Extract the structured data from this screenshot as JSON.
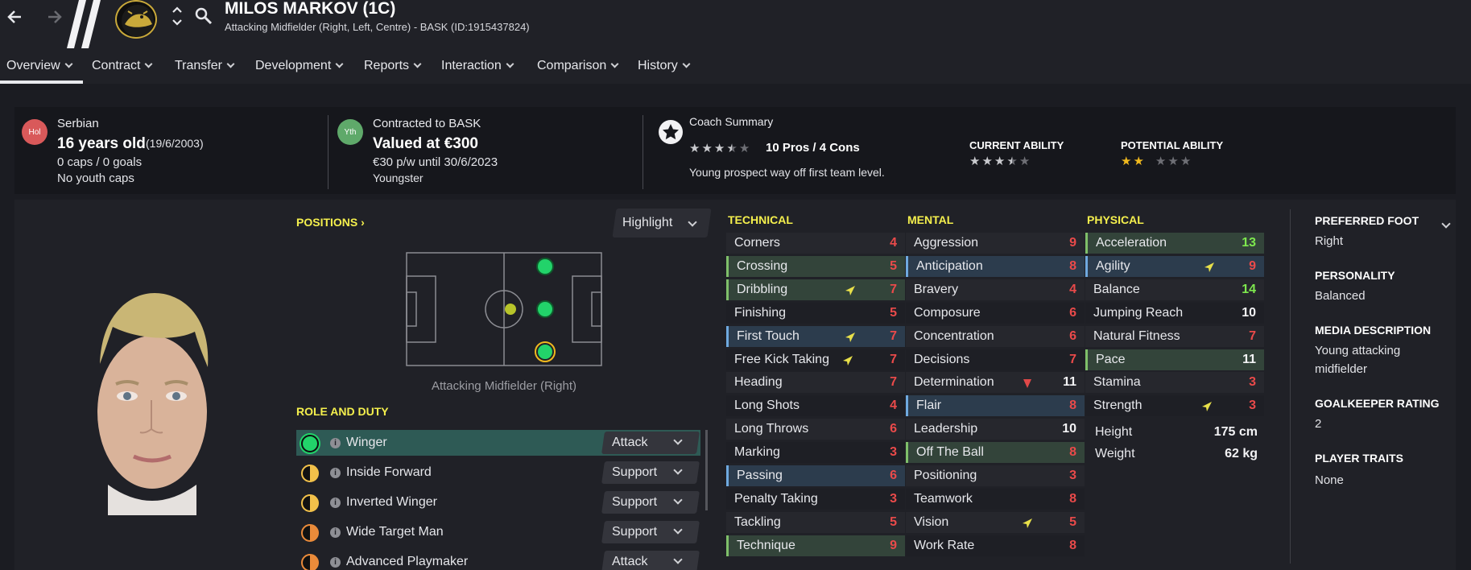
{
  "header": {
    "title": "MILOS MARKOV (1C)",
    "subtitle": "Attacking Midfielder (Right, Left, Centre) - BASK (ID:1915437824)"
  },
  "tabs": [
    "Overview",
    "Contract",
    "Transfer",
    "Development",
    "Reports",
    "Interaction",
    "Comparison",
    "History"
  ],
  "info": {
    "nation_badge": "Hol",
    "nationality": "Serbian",
    "age": "16 years old",
    "dob": "(19/6/2003)",
    "caps": "0 caps / 0 goals",
    "youth_caps": "No youth caps",
    "contract_badge": "Yth",
    "contracted": "Contracted to BASK",
    "valued": "Valued at €300",
    "wage": "€30 p/w until 30/6/2023",
    "status": "Youngster",
    "coach_title": "Coach Summary",
    "coach_rating": 3.5,
    "pros_cons": "10 Pros / 4 Cons",
    "coach_text": "Young prospect way off first team level.",
    "current_ability_label": "CURRENT ABILITY",
    "current_ability": 3.5,
    "potential_ability_label": "POTENTIAL ABILITY",
    "potential_ability": 2
  },
  "positions": {
    "label": "POSITIONS",
    "highlight": "Highlight",
    "caption": "Attacking Midfielder (Right)"
  },
  "roles": {
    "label": "ROLE AND DUTY",
    "items": [
      {
        "name": "Winger",
        "duty": "Attack"
      },
      {
        "name": "Inside Forward",
        "duty": "Support"
      },
      {
        "name": "Inverted Winger",
        "duty": "Support"
      },
      {
        "name": "Wide Target Man",
        "duty": "Support"
      },
      {
        "name": "Advanced Playmaker",
        "duty": "Attack"
      }
    ]
  },
  "technical": {
    "label": "TECHNICAL",
    "items": [
      {
        "name": "Corners",
        "value": "4"
      },
      {
        "name": "Crossing",
        "value": "5"
      },
      {
        "name": "Dribbling",
        "value": "7"
      },
      {
        "name": "Finishing",
        "value": "5"
      },
      {
        "name": "First Touch",
        "value": "7"
      },
      {
        "name": "Free Kick Taking",
        "value": "7"
      },
      {
        "name": "Heading",
        "value": "7"
      },
      {
        "name": "Long Shots",
        "value": "4"
      },
      {
        "name": "Long Throws",
        "value": "6"
      },
      {
        "name": "Marking",
        "value": "3"
      },
      {
        "name": "Passing",
        "value": "6"
      },
      {
        "name": "Penalty Taking",
        "value": "3"
      },
      {
        "name": "Tackling",
        "value": "5"
      },
      {
        "name": "Technique",
        "value": "9"
      }
    ]
  },
  "mental": {
    "label": "MENTAL",
    "items": [
      {
        "name": "Aggression",
        "value": "9"
      },
      {
        "name": "Anticipation",
        "value": "8"
      },
      {
        "name": "Bravery",
        "value": "4"
      },
      {
        "name": "Composure",
        "value": "6"
      },
      {
        "name": "Concentration",
        "value": "6"
      },
      {
        "name": "Decisions",
        "value": "7"
      },
      {
        "name": "Determination",
        "value": "11"
      },
      {
        "name": "Flair",
        "value": "8"
      },
      {
        "name": "Leadership",
        "value": "10"
      },
      {
        "name": "Off The Ball",
        "value": "8"
      },
      {
        "name": "Positioning",
        "value": "3"
      },
      {
        "name": "Teamwork",
        "value": "8"
      },
      {
        "name": "Vision",
        "value": "5"
      },
      {
        "name": "Work Rate",
        "value": "8"
      }
    ]
  },
  "physical": {
    "label": "PHYSICAL",
    "items": [
      {
        "name": "Acceleration",
        "value": "13"
      },
      {
        "name": "Agility",
        "value": "9"
      },
      {
        "name": "Balance",
        "value": "14"
      },
      {
        "name": "Jumping Reach",
        "value": "10"
      },
      {
        "name": "Natural Fitness",
        "value": "7"
      },
      {
        "name": "Pace",
        "value": "11"
      },
      {
        "name": "Stamina",
        "value": "3"
      },
      {
        "name": "Strength",
        "value": "3"
      }
    ],
    "height_label": "Height",
    "height": "175 cm",
    "weight_label": "Weight",
    "weight": "62 kg"
  },
  "right_panel": {
    "preferred_foot_label": "PREFERRED FOOT",
    "preferred_foot": "Right",
    "personality_label": "PERSONALITY",
    "personality": "Balanced",
    "media_label": "MEDIA DESCRIPTION",
    "media_line1": "Young attacking",
    "media_line2": "midfielder",
    "gk_label": "GOALKEEPER RATING",
    "gk_value": "2",
    "traits_label": "PLAYER TRAITS",
    "traits": "None"
  },
  "colors": {
    "accent_yellow": "#f5f04d",
    "bad_red": "#ea4a4a",
    "good_green": "#7ee84e",
    "highlight_teal": "#2e5a55"
  }
}
